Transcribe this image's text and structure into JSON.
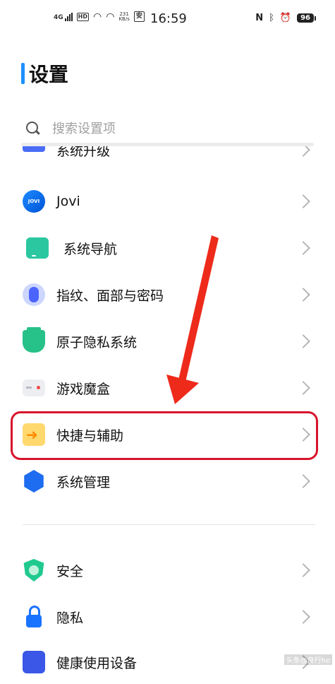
{
  "status_bar": {
    "network": "4G",
    "hd": "HD",
    "speed": "231\nKB/s",
    "app_badge": "安",
    "time": "16:59",
    "battery": "96",
    "icons": [
      "nfc-icon",
      "bluetooth-icon",
      "alarm-icon"
    ]
  },
  "page": {
    "title": "设置"
  },
  "search": {
    "placeholder": "搜索设置项"
  },
  "settings": {
    "items": [
      {
        "label": "系统升级",
        "icon": "system-upgrade-icon"
      },
      {
        "label": "Jovi",
        "icon": "jovi-icon",
        "icon_text": "JOVI"
      },
      {
        "label": "系统导航",
        "icon": "phone-navigation-icon"
      },
      {
        "label": "指纹、面部与密码",
        "icon": "fingerprint-icon"
      },
      {
        "label": "原子隐私系统",
        "icon": "atom-privacy-icon"
      },
      {
        "label": "游戏魔盒",
        "icon": "game-box-icon"
      },
      {
        "label": "快捷与辅助",
        "icon": "shortcut-arrow-icon"
      },
      {
        "label": "系统管理",
        "icon": "system-management-icon"
      },
      {
        "label": "安全",
        "icon": "security-shield-icon"
      },
      {
        "label": "隐私",
        "icon": "privacy-lock-icon"
      },
      {
        "label": "健康使用设备",
        "icon": "health-usage-icon"
      }
    ]
  },
  "annotation": {
    "highlighted_item": "快捷与辅助",
    "color": "#d8132c"
  },
  "watermark": "头条@良行he"
}
